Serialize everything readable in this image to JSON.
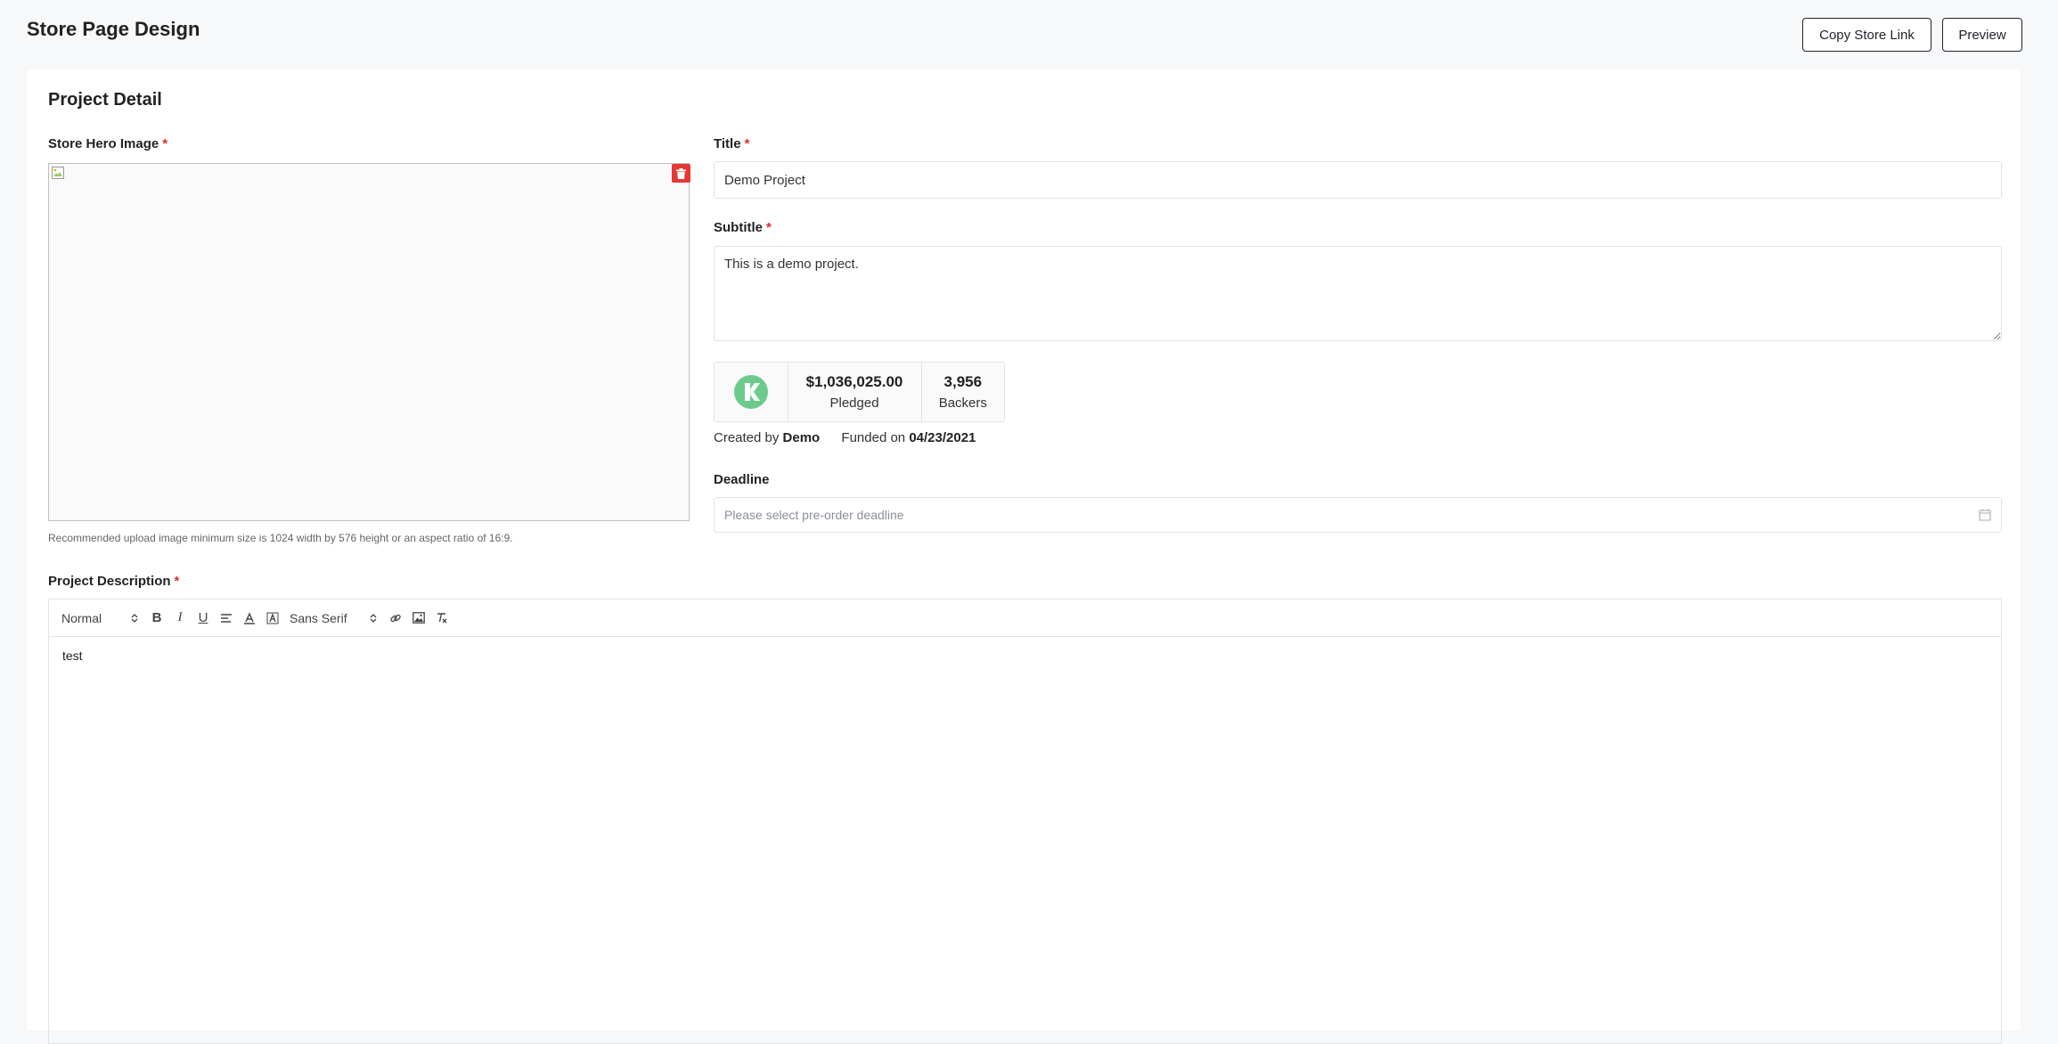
{
  "header": {
    "title": "Store Page Design",
    "copy_link_label": "Copy Store Link",
    "preview_label": "Preview"
  },
  "card": {
    "section_title": "Project Detail",
    "hero": {
      "label": "Store Hero Image",
      "required_mark": "*",
      "hint": "Recommended upload image minimum size is 1024 width by 576 height or an aspect ratio of 16:9."
    },
    "title_field": {
      "label": "Title",
      "required_mark": "*",
      "value": "Demo Project"
    },
    "subtitle_field": {
      "label": "Subtitle",
      "required_mark": "*",
      "value": "This is a demo project."
    },
    "stats": {
      "logo_icon": "kickstarter-logo",
      "logo_color": "#05ce78",
      "pledged_value": "$1,036,025.00",
      "pledged_label": "Pledged",
      "backers_value": "3,956",
      "backers_label": "Backers"
    },
    "meta": {
      "created_prefix": "Created by",
      "creator": "Demo",
      "funded_prefix": "Funded on",
      "funded_date": "04/23/2021"
    },
    "deadline": {
      "label": "Deadline",
      "placeholder": "Please select pre-order deadline",
      "icon": "calendar-icon"
    },
    "description": {
      "label": "Project Description",
      "required_mark": "*",
      "format_select": "Normal",
      "font_select": "Sans Serif",
      "content": "test"
    }
  },
  "colors": {
    "danger": "#e53935",
    "required": "#d92b2b",
    "background": "#f7f8fa"
  }
}
